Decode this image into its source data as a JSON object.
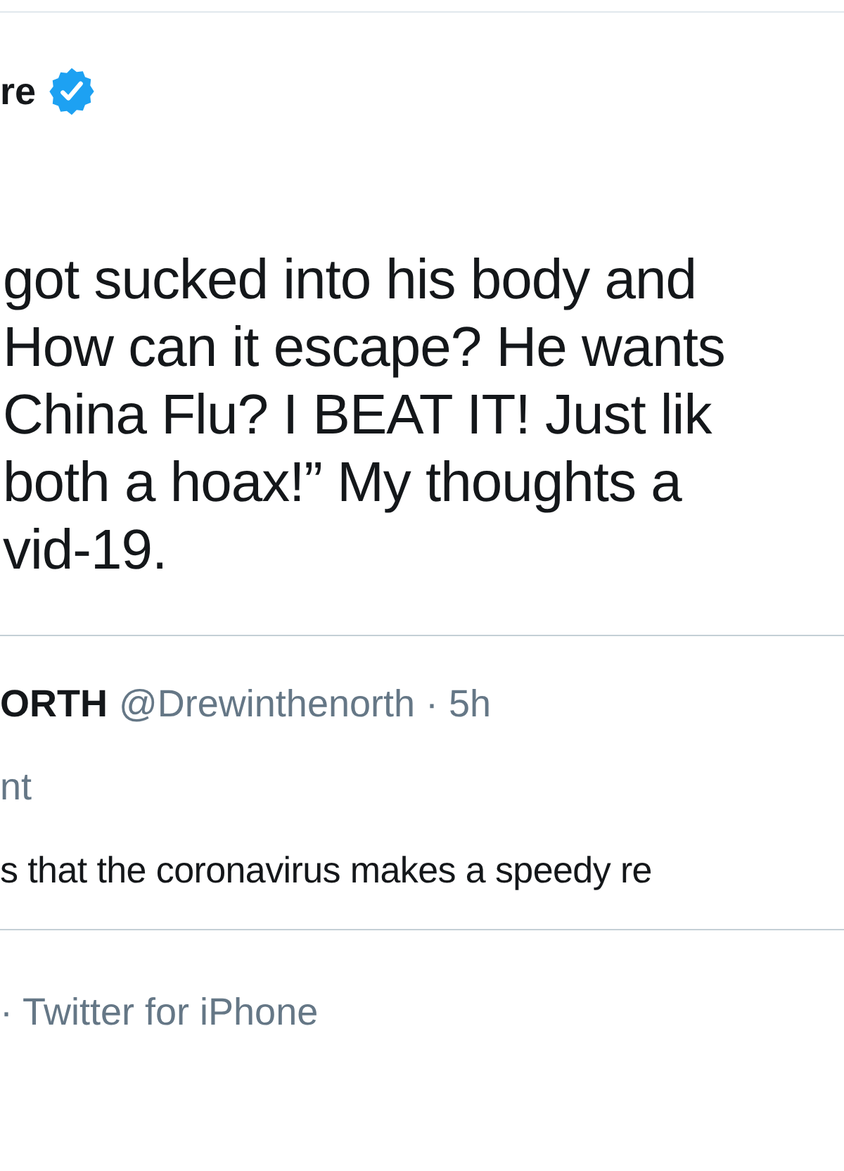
{
  "author": {
    "name": "re",
    "verified": true
  },
  "text_lines": [
    "got sucked into his body and",
    "How can it escape? He wants",
    "China Flu? I BEAT IT! Just lik",
    "both a hoax!” My thoughts a",
    "vid-19."
  ],
  "quoted_tweet": {
    "name": "ORTH",
    "meta": "@Drewinthenorth · 5h",
    "line_2": "nt",
    "text": "s that the coronavirus makes a speedy re"
  },
  "footer": {
    "source": "· Twitter for iPhone"
  }
}
